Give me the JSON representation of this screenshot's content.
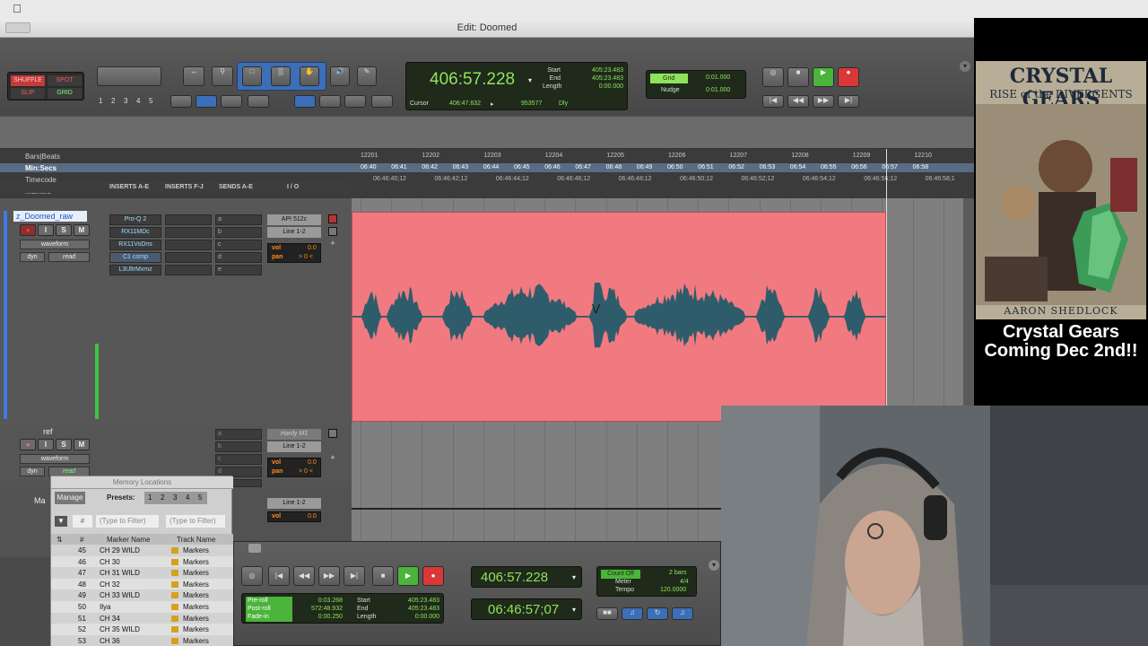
{
  "window": {
    "title": "Edit: Doomed"
  },
  "modes": {
    "shuffle": "SHUFFLE",
    "spot": "SPOT",
    "slip": "SLIP",
    "grid": "GRID"
  },
  "zoom_presets": [
    "1",
    "2",
    "3",
    "4",
    "5"
  ],
  "main_counter": {
    "value": "406:57.228",
    "start_label": "Start",
    "end_label": "End",
    "length_label": "Length",
    "start": "405:23.483",
    "end": "405:23.483",
    "length": "0:00.000",
    "cursor_label": "Cursor",
    "cursor": "406:47.632",
    "sample": "953577",
    "dly": "Dly"
  },
  "grid": {
    "label": "Grid",
    "value": "0:01.000",
    "nudge_label": "Nudge",
    "nudge_value": "0:01.000"
  },
  "rulers": {
    "bars_beats": "Bars|Beats",
    "min_secs": "Min:Secs",
    "timecode": "Timecode",
    "markers": "Markers",
    "bars": [
      "12201",
      "12202",
      "12203",
      "12204",
      "12205",
      "12206",
      "12207",
      "12208",
      "12209",
      "12210"
    ],
    "minsecs": [
      "06:40",
      "06:41",
      "06:42",
      "06:43",
      "06:44",
      "06:45",
      "06:46",
      "06:47",
      "06:48",
      "06:49",
      "06:50",
      "06:51",
      "06:52",
      "06:53",
      "06:54",
      "06:55",
      "06:56",
      "06:57",
      "06:58"
    ],
    "timecodes": [
      "06:46:40;12",
      "06:46:42;12",
      "06:46:44;12",
      "06:46:46;12",
      "06:46:48;12",
      "06:46:50;12",
      "06:46:52;12",
      "06:46:54;12",
      "06:46:56;12",
      "06:46:58;1"
    ]
  },
  "columns": {
    "inserts_ae": "INSERTS A-E",
    "inserts_fj": "INSERTS F-J",
    "sends_ae": "SENDS A-E",
    "io": "I / O"
  },
  "track1": {
    "name": "z_Doomed_raw",
    "view": "waveform",
    "dyn": "dyn",
    "auto": "read",
    "inserts": [
      "Pro-Q 2",
      "RX11MDc",
      "RX11VoDns",
      "C1 comp",
      "L3UltrMxmz"
    ],
    "sends": [
      "a",
      "b",
      "c",
      "d",
      "e"
    ],
    "input": "API 512c",
    "output": "Line 1-2",
    "vol_label": "vol",
    "vol": "0.0",
    "pan_label": "pan",
    "pan": "> 0 <"
  },
  "track2": {
    "name": "ref",
    "view": "waveform",
    "dyn": "dyn",
    "auto": "read",
    "sends": [
      "a",
      "b",
      "c",
      "d",
      "e"
    ],
    "input": "Hardy M1",
    "output": "Line 1-2",
    "vol_label": "vol",
    "vol": "0.0",
    "pan_label": "pan",
    "pan": "> 0 <"
  },
  "track3": {
    "name": "Ma",
    "output": "Line 1-2",
    "vol_label": "vol",
    "vol": "0.0"
  },
  "memory": {
    "title": "Memory Locations",
    "manage": "Manage",
    "presets_label": "Presets:",
    "presets": [
      "1",
      "2",
      "3",
      "4",
      "5"
    ],
    "filter1": "(Type to Filter)",
    "filter2": "(Type to Filter)",
    "col_num": "#",
    "col_name": "Marker Name",
    "col_track": "Track Name",
    "rows": [
      {
        "n": "45",
        "name": "CH 29 WILD",
        "track": "Markers"
      },
      {
        "n": "46",
        "name": "CH 30",
        "track": "Markers"
      },
      {
        "n": "47",
        "name": "CH 31 WILD",
        "track": "Markers"
      },
      {
        "n": "48",
        "name": "CH 32",
        "track": "Markers"
      },
      {
        "n": "49",
        "name": "CH 33 WILD",
        "track": "Markers"
      },
      {
        "n": "50",
        "name": "Ilya",
        "track": "Markers"
      },
      {
        "n": "51",
        "name": "CH 34",
        "track": "Markers"
      },
      {
        "n": "52",
        "name": "CH 35 WILD",
        "track": "Markers"
      },
      {
        "n": "53",
        "name": "CH 36",
        "track": "Markers"
      }
    ]
  },
  "transport": {
    "main": "406:57.228",
    "sub": "06:46:57;07",
    "preroll_label": "Pre-roll",
    "preroll": "0:03.268",
    "postroll_label": "Post-roll",
    "postroll": "572:48.932",
    "fadein_label": "Fade-in",
    "fadein": "0:00.250",
    "start_label": "Start",
    "start": "405:23.483",
    "end_label": "End",
    "end": "405:23.483",
    "length_label": "Length",
    "length": "0:00.000",
    "countoff": "Count Off",
    "bars": "2 bars",
    "meter_label": "Meter",
    "meter": "4/4",
    "tempo_label": "Tempo",
    "tempo": "120.0000"
  },
  "ad": {
    "title_line1": "CRYSTAL GEARS",
    "title_line2": "RISE of the DIVERGENTS",
    "author": "AARON SHEDLOCK",
    "tagline": "Crystal Gears Coming Dec 2nd!!",
    "accent": "#f04a50"
  }
}
